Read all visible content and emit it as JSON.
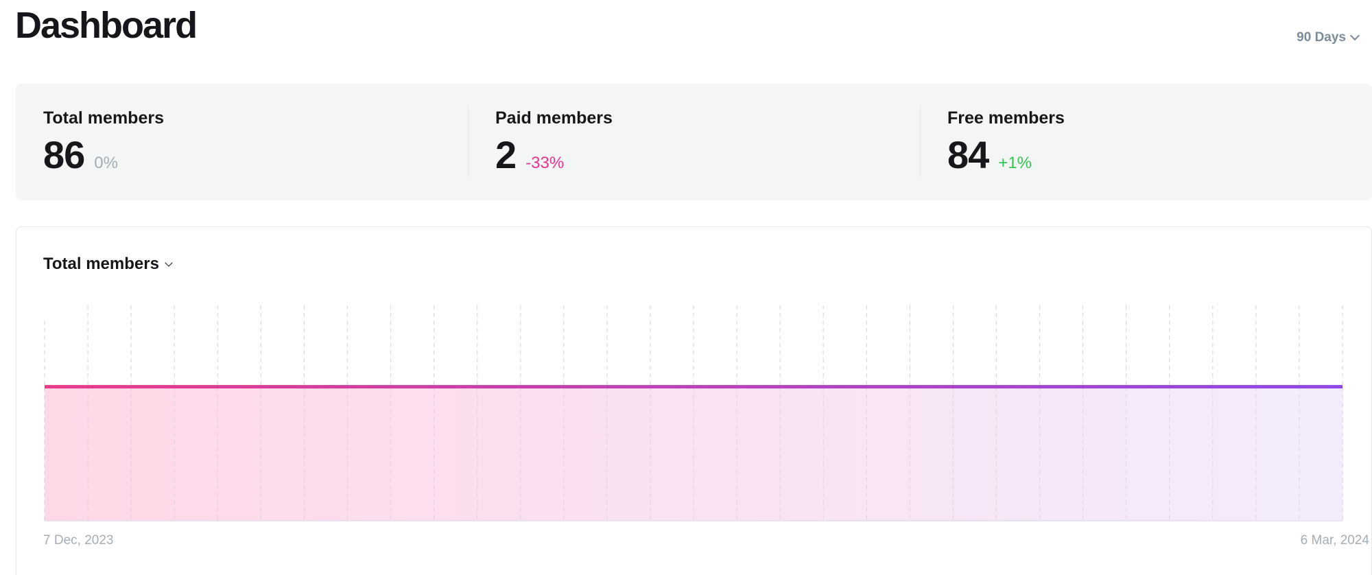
{
  "header": {
    "title": "Dashboard",
    "range_label": "90 Days"
  },
  "stats": [
    {
      "label": "Total members",
      "value": "86",
      "delta": "0%",
      "delta_color": "#a2acb6"
    },
    {
      "label": "Paid members",
      "value": "2",
      "delta": "-33%",
      "delta_color": "#ea3392"
    },
    {
      "label": "Free members",
      "value": "84",
      "delta": "+1%",
      "delta_color": "#30c651"
    }
  ],
  "chart": {
    "metric_label": "Total members",
    "start_label": "7 Dec, 2023",
    "end_label": "6 Mar, 2024"
  },
  "chart_data": {
    "type": "area",
    "series": [
      {
        "name": "Total members",
        "values": [
          86,
          86,
          86,
          86,
          86,
          86,
          86,
          86,
          86,
          86,
          86,
          86,
          86,
          86,
          86,
          86,
          86,
          86,
          86,
          86,
          86,
          86,
          86,
          86,
          86,
          86,
          86,
          86,
          86,
          86,
          86
        ]
      }
    ],
    "x_start": "7 Dec, 2023",
    "x_end": "6 Mar, 2024",
    "xlabel": "",
    "ylabel": "",
    "grid": "vertical-dashed",
    "colors": {
      "start": "#e83a8a",
      "end": "#8e47e6"
    }
  }
}
